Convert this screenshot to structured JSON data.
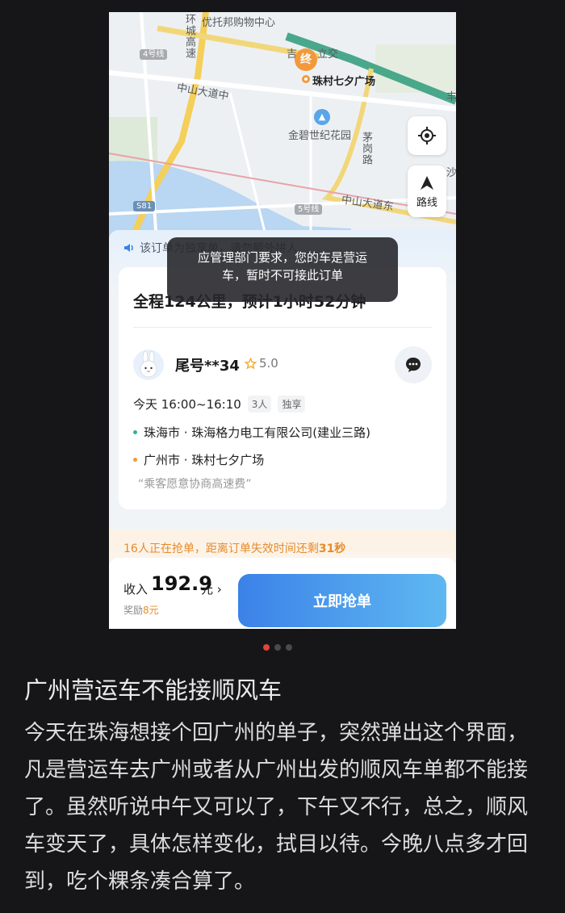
{
  "map": {
    "labels": {
      "mall": "优托邦购物中心",
      "huancheng_expwy": "环城高速",
      "line4": "4号线",
      "zhongshan_road": "中山大道中",
      "jinbi_garden": "金碧世纪花园",
      "maogang_road": "茅岗路",
      "zhongshan_east": "中山大道东",
      "line5": "5号线",
      "s81": "S81",
      "ji_li_jiao": "吉",
      "li_jiao": "立交",
      "feng": "丰",
      "sha": "沙"
    },
    "end_pin": "终",
    "destination_label": "珠村七夕广场",
    "route_button": "路线"
  },
  "panel": {
    "notice": "该订单为独享单，请勿额外拼人",
    "summary": "全程124公里，预计1小时52分钟",
    "passenger": "尾号**34",
    "rating": "5.0",
    "time": "今天 16:00~16:10",
    "seats": "3人",
    "type": "独享",
    "from": "珠海市 · 珠海格力电工有限公司(建业三路)",
    "to": "广州市 · 珠村七夕广场",
    "note": "“乘客愿意协商高速费”",
    "alert_prefix": "16人正在抢单，距离订单失效时间还剩",
    "alert_seconds": "31秒",
    "income_label": "收入",
    "income": "192.9",
    "income_unit": "元",
    "bonus_label": "奖励",
    "bonus_value": "8元",
    "grab_button": "立即抢单"
  },
  "toast": {
    "line1": "应管理部门要求，您的车是营运",
    "line2": "车，暂时不可接此订单"
  },
  "post": {
    "title": "广州营运车不能接顺风车",
    "body": "今天在珠海想接个回广州的单子，突然弹出这个界面，凡是营运车去广州或者从广州出发的顺风车单都不能接了。虽然听说中午又可以了，下午又不行，总之，顺风车变天了，具体怎样变化，拭目以待。今晚八点多才回到，吃个粿条凑合算了。"
  },
  "colors": {
    "accent_blue": "#3b82e8",
    "warning_orange": "#e58b2c",
    "pin_orange": "#f29a3b",
    "from_dot": "#2fb39a",
    "to_dot": "#f29a3b"
  }
}
